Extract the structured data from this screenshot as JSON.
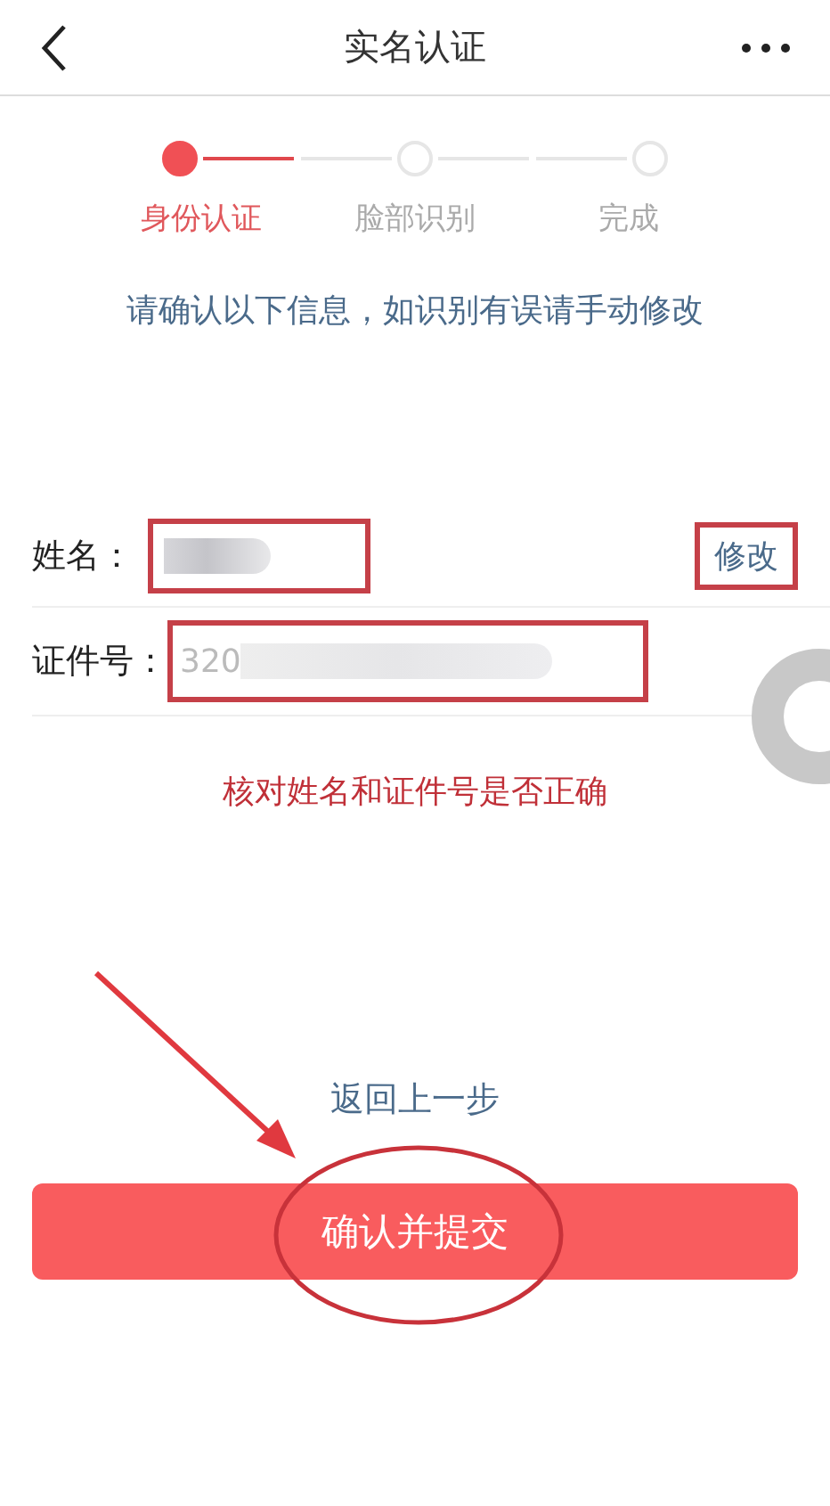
{
  "nav": {
    "title": "实名认证"
  },
  "steps": [
    {
      "label": "身份认证",
      "selected": true
    },
    {
      "label": "脸部识别",
      "selected": false
    },
    {
      "label": "完成",
      "selected": false
    }
  ],
  "instruction": "请确认以下信息，如识别有误请手动修改",
  "fields": [
    {
      "label": "姓名：",
      "redacted": true,
      "action": "修改"
    },
    {
      "label": "证件号：",
      "value": "320",
      "redacted": true
    }
  ],
  "annotation_note": "核对姓名和证件号是否正确",
  "back_link": "返回上一步",
  "submit": "确认并提交"
}
